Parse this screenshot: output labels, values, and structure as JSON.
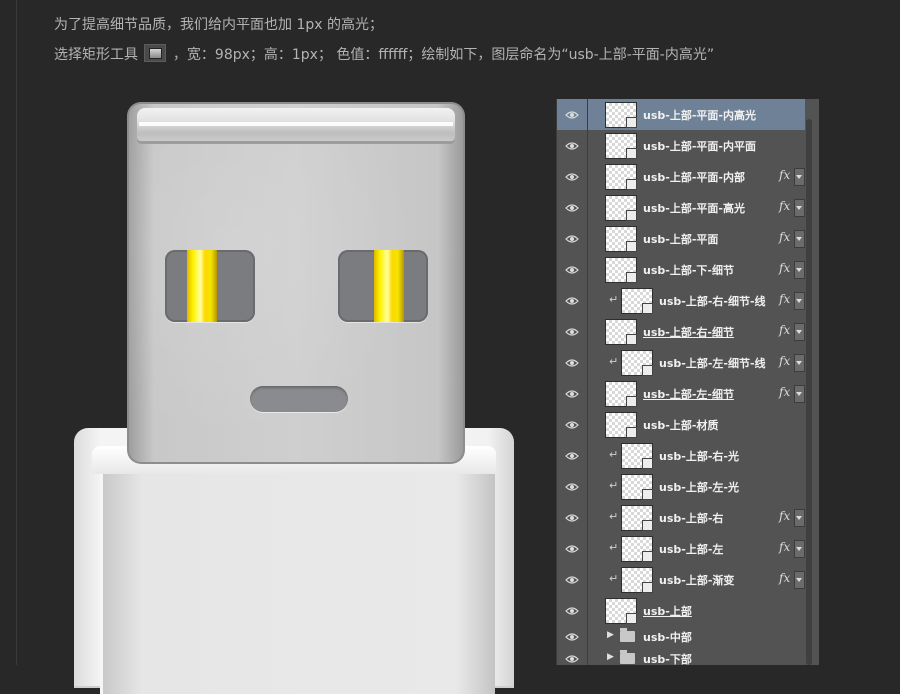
{
  "instructions": {
    "line1": "为了提高细节品质，我们给内平面也加 1px 的高光；",
    "line2_before": "选择矩形工具",
    "line2_after": "，宽：98px；高：1px；  色值：ffffff；绘制如下，图层命名为“usb-上部-平面-内高光”"
  },
  "layers": [
    {
      "name": "usb-上部-平面-内高光",
      "selected": true,
      "clipped": false,
      "fx": false,
      "underline": false
    },
    {
      "name": "usb-上部-平面-内平面",
      "selected": false,
      "clipped": false,
      "fx": false,
      "underline": false
    },
    {
      "name": "usb-上部-平面-内部",
      "selected": false,
      "clipped": false,
      "fx": true,
      "underline": false
    },
    {
      "name": "usb-上部-平面-高光",
      "selected": false,
      "clipped": false,
      "fx": true,
      "underline": false
    },
    {
      "name": "usb-上部-平面",
      "selected": false,
      "clipped": false,
      "fx": true,
      "underline": false
    },
    {
      "name": "usb-上部-下-细节",
      "selected": false,
      "clipped": false,
      "fx": true,
      "underline": false
    },
    {
      "name": "usb-上部-右-细节-线",
      "selected": false,
      "clipped": true,
      "fx": true,
      "underline": false
    },
    {
      "name": "usb-上部-右-细节",
      "selected": false,
      "clipped": false,
      "fx": true,
      "underline": true
    },
    {
      "name": "usb-上部-左-细节-线",
      "selected": false,
      "clipped": true,
      "fx": true,
      "underline": false
    },
    {
      "name": "usb-上部-左-细节",
      "selected": false,
      "clipped": false,
      "fx": true,
      "underline": true
    },
    {
      "name": "usb-上部-材质",
      "selected": false,
      "clipped": false,
      "fx": false,
      "underline": false
    },
    {
      "name": "usb-上部-右-光",
      "selected": false,
      "clipped": true,
      "fx": false,
      "underline": false
    },
    {
      "name": "usb-上部-左-光",
      "selected": false,
      "clipped": true,
      "fx": false,
      "underline": false
    },
    {
      "name": "usb-上部-右",
      "selected": false,
      "clipped": true,
      "fx": true,
      "underline": false
    },
    {
      "name": "usb-上部-左",
      "selected": false,
      "clipped": true,
      "fx": true,
      "underline": false
    },
    {
      "name": "usb-上部-渐变",
      "selected": false,
      "clipped": true,
      "fx": true,
      "underline": false
    },
    {
      "name": "usb-上部",
      "selected": false,
      "clipped": false,
      "fx": false,
      "underline": true
    }
  ],
  "groups": [
    {
      "name": "usb-中部"
    },
    {
      "name": "usb-下部"
    }
  ],
  "icons": {
    "visibility": "eye-icon",
    "clip": "clip-arrow-icon",
    "fx": "fx-icon",
    "group": "folder-icon"
  },
  "labels": {
    "fx": "fx",
    "clip": "↵"
  },
  "colors": {
    "selected_row": "#6e8196",
    "panel_bg": "#535353",
    "page_bg": "#282828",
    "pin_yellow": "#fff200"
  }
}
